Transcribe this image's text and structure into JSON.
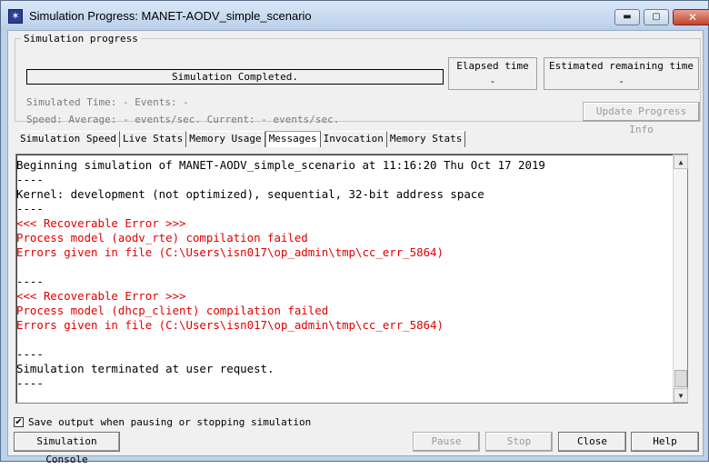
{
  "window": {
    "title": "Simulation Progress: MANET-AODV_simple_scenario",
    "controls": {
      "minimize": "▬",
      "maximize": "▢",
      "close": "✕"
    }
  },
  "progress": {
    "group_label": "Simulation progress",
    "status": "Simulation Completed.",
    "elapsed_label": "Elapsed time",
    "elapsed_value": "-",
    "remaining_label": "Estimated remaining time",
    "remaining_value": "-",
    "sim_time_line": "Simulated Time: - Events: -",
    "speed_line": "Speed: Average: - events/sec. Current: - events/sec.",
    "update_button": "Update Progress Info"
  },
  "tabs": [
    {
      "label": "Simulation Speed"
    },
    {
      "label": "Live Stats"
    },
    {
      "label": "Memory Usage"
    },
    {
      "label": "Messages",
      "active": true
    },
    {
      "label": "Invocation"
    },
    {
      "label": "Memory Stats"
    }
  ],
  "log": [
    {
      "text": "Beginning simulation of MANET-AODV_simple_scenario at 11:16:20 Thu Oct 17 2019",
      "error": false
    },
    {
      "text": "----",
      "error": false
    },
    {
      "text": "Kernel: development (not optimized), sequential, 32-bit address space",
      "error": false
    },
    {
      "text": "----",
      "error": false
    },
    {
      "text": "<<< Recoverable Error >>>",
      "error": true
    },
    {
      "text": "Process model (aodv_rte) compilation failed",
      "error": true
    },
    {
      "text": "Errors given in file (C:\\Users\\isn017\\op_admin\\tmp\\cc_err_5864)",
      "error": true
    },
    {
      "text": "",
      "error": false
    },
    {
      "text": "----",
      "error": false
    },
    {
      "text": "<<< Recoverable Error >>>",
      "error": true
    },
    {
      "text": "Process model (dhcp_client) compilation failed",
      "error": true
    },
    {
      "text": "Errors given in file (C:\\Users\\isn017\\op_admin\\tmp\\cc_err_5864)",
      "error": true
    },
    {
      "text": "",
      "error": false
    },
    {
      "text": "----",
      "error": false
    },
    {
      "text": "Simulation terminated at user request.",
      "error": false
    },
    {
      "text": "----",
      "error": false
    }
  ],
  "save_output": {
    "checked": true,
    "mark": "✔",
    "label": "Save output when pausing or stopping simulation"
  },
  "buttons": {
    "console": "Simulation Console",
    "pause": "Pause",
    "stop": "Stop",
    "close": "Close",
    "help": "Help"
  },
  "scrollbar": {
    "up": "▲",
    "down": "▼"
  },
  "colors": {
    "error_text": "#e00000",
    "title_bar": "#c8daf0"
  }
}
